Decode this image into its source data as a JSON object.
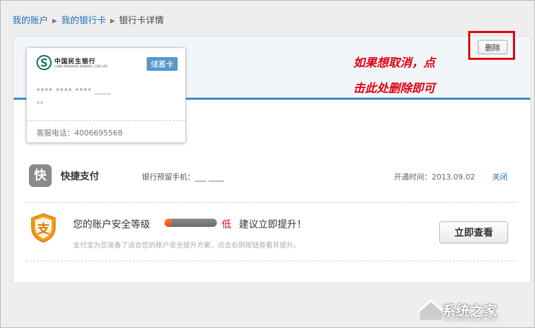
{
  "breadcrumb": {
    "items": [
      "我的账户",
      "我的银行卡"
    ],
    "current": "银行卡详情",
    "separator": "▶"
  },
  "bank_card": {
    "bank_name_cn": "中国民生银行",
    "bank_name_en": "CHINA MINSHENG BANKING CORP.,LTD.",
    "card_type": "储蓄卡",
    "card_number_masked": "**** **** **** ____",
    "holder_name": "**",
    "service_phone": "客服电话：4006695568"
  },
  "annotation": {
    "line1": "如果想取消，点",
    "line2": "击此处删除即可"
  },
  "delete_label": "删除",
  "quick_pay": {
    "icon_char": "快",
    "title": "快捷支付",
    "mobile": "银行预留手机：___ ____",
    "opened": "开通时间：2013.09.02",
    "close_label": "关闭"
  },
  "security": {
    "title": "您的账户安全等级",
    "level": "低",
    "level_fraction": 0.15,
    "advice": "建议立即提升！",
    "subtext": "支付宝为您准备了适合您的账户安全提升方案，点击右侧按钮查看并提升。",
    "button_label": "立即查看",
    "shield_char": "支"
  },
  "watermark": {
    "text": "系统之家",
    "url": "XITONGZHIJIA.NET"
  },
  "colors": {
    "accent_blue": "#3d8ac6",
    "link": "#1f6fb2",
    "annotation_red": "#e3000f",
    "bank_teal": "#0b6a5c",
    "shield_orange": "#f39a1e"
  }
}
